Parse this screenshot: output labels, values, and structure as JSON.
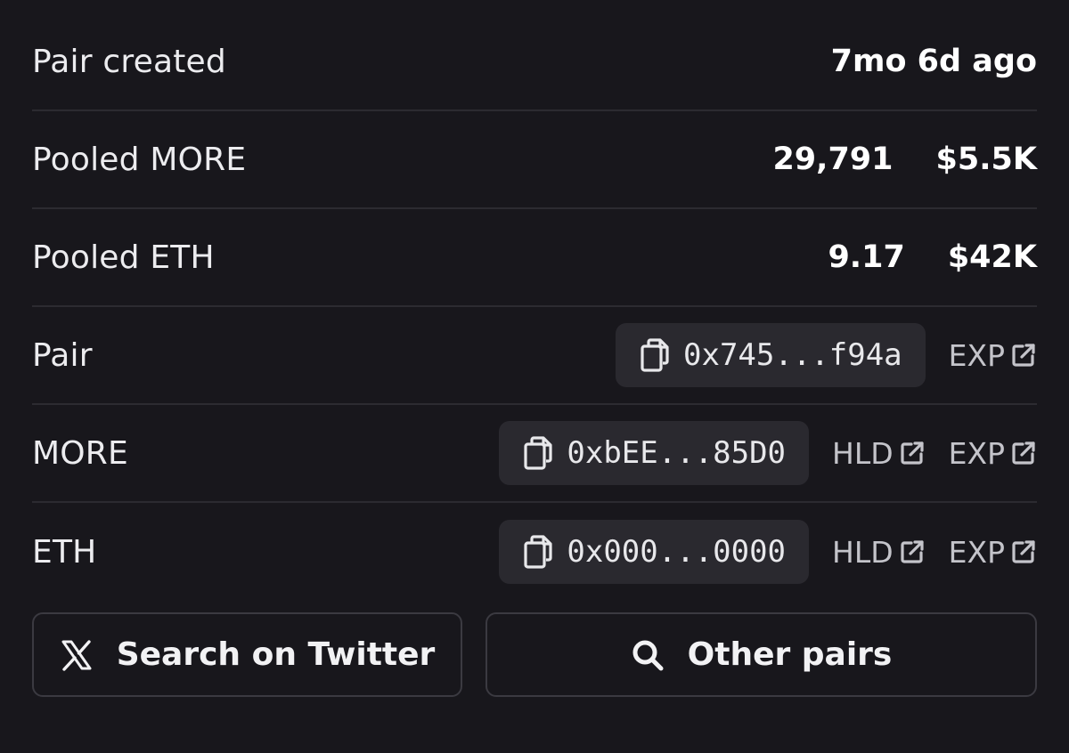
{
  "rows": {
    "pair_created": {
      "label": "Pair created",
      "value": "7mo 6d ago"
    },
    "pooled_more": {
      "label": "Pooled MORE",
      "amount": "29,791",
      "usd": "$5.5K"
    },
    "pooled_eth": {
      "label": "Pooled ETH",
      "amount": "9.17",
      "usd": "$42K"
    },
    "pair": {
      "label": "Pair",
      "address": "0x745...f94a",
      "exp_label": "EXP"
    },
    "more": {
      "label": "MORE",
      "address": "0xbEE...85D0",
      "hld_label": "HLD",
      "exp_label": "EXP"
    },
    "eth": {
      "label": "ETH",
      "address": "0x000...0000",
      "hld_label": "HLD",
      "exp_label": "EXP"
    }
  },
  "buttons": {
    "twitter": {
      "label": "Search on Twitter",
      "icon": "x-logo-icon"
    },
    "other_pairs": {
      "label": "Other pairs",
      "icon": "search-icon"
    }
  },
  "icons": {
    "copy": "copy-icon",
    "external_link": "external-link-icon"
  },
  "colors": {
    "background": "#18171c",
    "chip": "#2a292f",
    "divider": "#2c2b31",
    "muted_text": "#c4c4ca"
  }
}
